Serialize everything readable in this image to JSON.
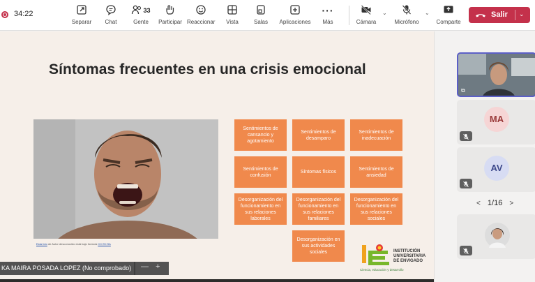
{
  "call": {
    "timer": "34:22"
  },
  "toolbar": {
    "items": [
      {
        "label": "Separar",
        "icon": "pop-out-icon"
      },
      {
        "label": "Chat",
        "icon": "chat-icon"
      },
      {
        "label": "Gente",
        "icon": "people-icon",
        "count": "33"
      },
      {
        "label": "Participar",
        "icon": "raise-hand-icon"
      },
      {
        "label": "Reaccionar",
        "icon": "emoji-icon"
      },
      {
        "label": "Vista",
        "icon": "view-grid-icon"
      },
      {
        "label": "Salas",
        "icon": "rooms-icon"
      },
      {
        "label": "Aplicaciones",
        "icon": "apps-plus-icon"
      },
      {
        "label": "Más",
        "icon": "more-icon"
      },
      {
        "label": "Cámara",
        "icon": "camera-off-icon"
      },
      {
        "label": "Micrófono",
        "icon": "mic-off-icon"
      },
      {
        "label": "Comparte",
        "icon": "share-icon"
      }
    ],
    "leave_label": "Salir",
    "colors": {
      "leave": "#c4314b",
      "accent": "#5b5fc7"
    }
  },
  "slide": {
    "title": "Síntomas frecuentes en una crisis emocional",
    "caption_link": "Esta foto",
    "caption_text": "de Autor desconocido está bajo licencia",
    "caption_license": "CC BY-SA",
    "boxes": [
      "Sentimientos de cansancio y agotamiento",
      "Sentimientos de desamparo",
      "Sentimientos de inadecuación",
      "Sentimientos de confusión",
      "Síntomas físicos",
      "Sentimientos de ansiedad",
      "Desorganización del funcionamiento en sus relaciones laborales",
      "Desorganización del funcionamiento en sus relaciones familiares",
      "Desorganización del funcionamiento en sus relaciones sociales",
      "Desorganización en sus actividades sociales"
    ],
    "box_color": "#f0894c",
    "logo": {
      "name_lines": [
        "INSTITUCIÓN",
        "UNIVERSITARIA",
        "DE ENVIGADO"
      ],
      "tagline": "Ciencia, educación y desarrollo"
    }
  },
  "presenter": {
    "name": "KA MAIRA POSADA LOPEZ (No comprobado)",
    "zoom_out": "—",
    "zoom_in": "+"
  },
  "rail": {
    "participants": [
      {
        "initials": "",
        "type": "video"
      },
      {
        "initials": "MA",
        "avatar_bg": "#f6d5d5",
        "avatar_fg": "#9a3a3a"
      },
      {
        "initials": "AV",
        "avatar_bg": "#d7dcf3",
        "avatar_fg": "#3e4a8c"
      },
      {
        "initials": "",
        "type": "photo"
      }
    ],
    "pager": "1/16"
  }
}
